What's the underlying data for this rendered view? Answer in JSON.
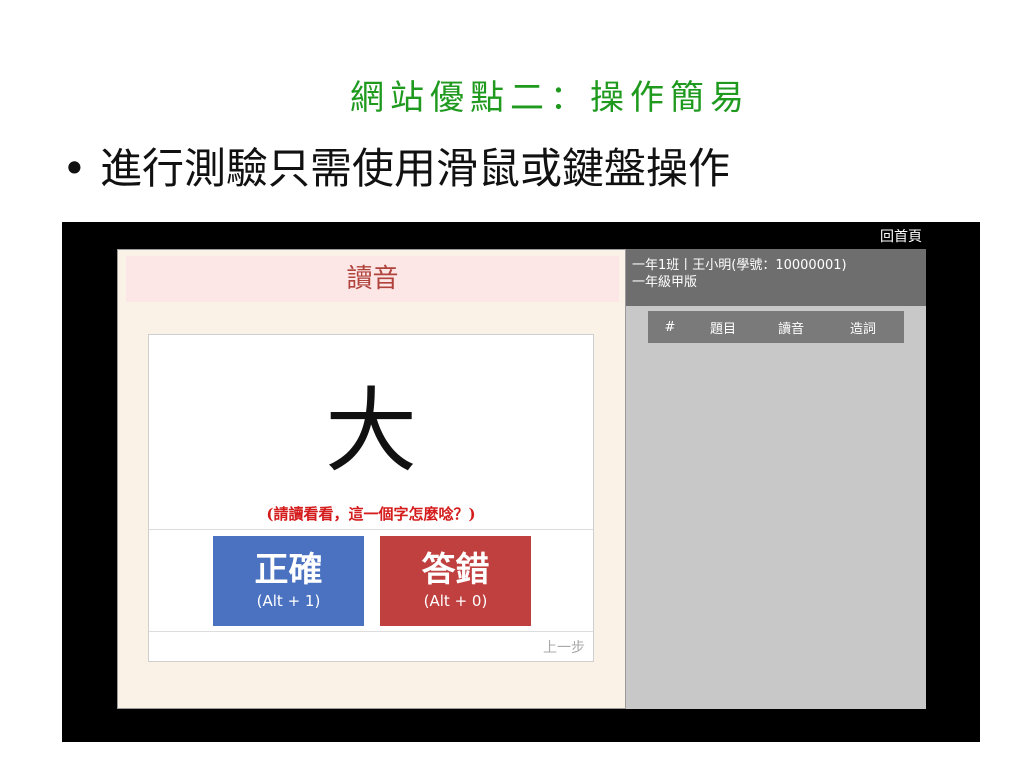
{
  "slide": {
    "title": "網站優點二：操作簡易",
    "bullet_marker": "•",
    "bullet": "進行測驗只需使用滑鼠或鍵盤操作"
  },
  "app": {
    "home_link": "回首頁",
    "panel_title": "讀音",
    "character": "大",
    "hint": "(請讀看看，這一個字怎麼唸？)",
    "correct_button": {
      "label": "正確",
      "shortcut": "(Alt + 1)"
    },
    "wrong_button": {
      "label": "答錯",
      "shortcut": "(Alt + 0)"
    },
    "prev_step": "上一步",
    "student": {
      "line1": "一年1班丨王小明(學號：10000001)",
      "line2": "一年級甲版"
    },
    "table_headers": [
      "#",
      "題目",
      "讀音",
      "造詞"
    ]
  },
  "colors": {
    "title_green": "#1f9a1f",
    "correct_blue": "#4a72c0",
    "wrong_red": "#c0403f",
    "hint_red": "#d51c1c",
    "panel_title_bg": "#fde6e6"
  }
}
